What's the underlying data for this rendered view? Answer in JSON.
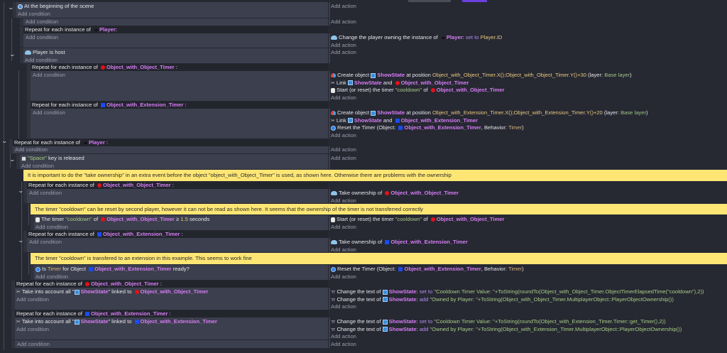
{
  "labels": {
    "add_condition": "Add condition",
    "add_action": "Add action"
  },
  "events": [
    {
      "conditions": [
        [
          {
            "icon": "scene-icon"
          },
          {
            "text": "At the beginning of the scene"
          }
        ]
      ],
      "actions": []
    },
    {
      "conditions": [],
      "actions": []
    },
    {
      "repeat": [
        {
          "text": "Repeat for each instance of "
        },
        {
          "icon": "player-object-icon"
        },
        {
          "text": "Player",
          "style": "obj"
        },
        {
          "text": ":"
        }
      ],
      "conditions": [],
      "actions": [
        [
          {
            "icon": "multiplayer-icon"
          },
          {
            "text": "Change the player owning the instance of "
          },
          {
            "icon": "player-object-icon"
          },
          {
            "text": "Player",
            "style": "obj"
          },
          {
            "text": ": "
          },
          {
            "text": "set to",
            "style": "kw"
          },
          {
            "text": " "
          },
          {
            "text": "Player.ID",
            "style": "expr"
          }
        ]
      ]
    },
    {
      "conditions": [
        [
          {
            "icon": "multiplayer-icon"
          },
          {
            "text": "Player is host"
          }
        ]
      ],
      "actions": []
    },
    {
      "repeat": [
        {
          "text": "Repeat for each instance of "
        },
        {
          "icon": "red-dot-icon"
        },
        {
          "text": "Object_with_Object_Timer",
          "style": "obj"
        },
        {
          "text": " :"
        }
      ],
      "conditions": [],
      "actions": [
        [
          {
            "icon": "create-object-icon"
          },
          {
            "text": "Create object "
          },
          {
            "icon": "showstate-icon"
          },
          {
            "text": "ShowState",
            "style": "obj"
          },
          {
            "text": " at position "
          },
          {
            "text": "Object_with_Object_Timer.X();Object_with_Object_Timer.Y()+30",
            "style": "expr"
          },
          {
            "text": " (layer: "
          },
          {
            "text": "Base layer",
            "style": "layer"
          },
          {
            "text": ")"
          }
        ],
        [
          {
            "icon": "link-icon"
          },
          {
            "text": "Link "
          },
          {
            "icon": "showstate-icon"
          },
          {
            "text": "ShowState",
            "style": "obj"
          },
          {
            "text": " and "
          },
          {
            "icon": "red-dot-icon"
          },
          {
            "text": "Object_with_Object_Timer",
            "style": "obj"
          }
        ],
        [
          {
            "icon": "timer-icon"
          },
          {
            "text": "Start (or reset) the timer "
          },
          {
            "text": "\"cooldown\"",
            "style": "str"
          },
          {
            "text": " of "
          },
          {
            "icon": "red-dot-icon"
          },
          {
            "text": "Object_with_Object_Timer",
            "style": "obj"
          }
        ]
      ]
    },
    {
      "repeat": [
        {
          "text": "Repeat for each instance of "
        },
        {
          "icon": "blue-square-icon"
        },
        {
          "text": "Object_with_Extension_Timer",
          "style": "obj"
        },
        {
          "text": " :"
        }
      ],
      "conditions": [],
      "actions": [
        [
          {
            "icon": "create-object-icon"
          },
          {
            "text": "Create object "
          },
          {
            "icon": "showstate-icon"
          },
          {
            "text": "ShowState",
            "style": "obj"
          },
          {
            "text": " at position "
          },
          {
            "text": "Object_with_Extension_Timer.X();Object_with_Extension_Timer.Y()+20",
            "style": "expr"
          },
          {
            "text": " (layer: "
          },
          {
            "text": "Base layer",
            "style": "layer"
          },
          {
            "text": ")"
          }
        ],
        [
          {
            "icon": "link-icon"
          },
          {
            "text": "Link "
          },
          {
            "icon": "showstate-icon"
          },
          {
            "text": "ShowState",
            "style": "obj"
          },
          {
            "text": " and "
          },
          {
            "icon": "blue-square-icon"
          },
          {
            "text": "Object_with_Extension_Timer",
            "style": "obj"
          }
        ],
        [
          {
            "icon": "extension-timer-icon"
          },
          {
            "text": "Reset the Timer (Object: "
          },
          {
            "icon": "blue-square-icon"
          },
          {
            "text": "Object_with_Extension_Timer",
            "style": "obj"
          },
          {
            "text": ", Behavior: "
          },
          {
            "text": "Timer",
            "style": "beh"
          },
          {
            "text": ")"
          }
        ]
      ]
    },
    {
      "repeat": [
        {
          "text": "Repeat for each instance of "
        },
        {
          "icon": "player-object-icon"
        },
        {
          "text": "Player",
          "style": "obj"
        },
        {
          "text": " :"
        }
      ],
      "conditions": [],
      "actions": []
    },
    {
      "conditions": [
        [
          {
            "icon": "keyboard-icon"
          },
          {
            "text": "\"Space\"",
            "style": "str"
          },
          {
            "text": " key is released"
          }
        ]
      ],
      "actions": []
    },
    {
      "comment": "It is important to do the \"take ownership\" in an extra event before the object \"object_with_Object_Timer\" is used, as shown here. Otherwise there are problems with the ownership"
    },
    {
      "repeat": [
        {
          "text": "Repeat for each instance of "
        },
        {
          "icon": "red-dot-icon"
        },
        {
          "text": "Object_with_Object_Timer",
          "style": "obj"
        },
        {
          "text": " :"
        }
      ],
      "conditions": [],
      "actions": [
        [
          {
            "icon": "multiplayer-icon"
          },
          {
            "text": "Take ownership of "
          },
          {
            "icon": "red-dot-icon"
          },
          {
            "text": "Object_with_Object_Timer",
            "style": "obj"
          }
        ]
      ]
    },
    {
      "comment": "The timer \"cooldown\" can be reset by second player, however it can not be read as shown here. It seems that the ownership of the timer is not transferred correctly"
    },
    {
      "conditions": [
        [
          {
            "icon": "timer-icon"
          },
          {
            "text": "The timer "
          },
          {
            "text": "\"cooldown\"",
            "style": "str"
          },
          {
            "text": " of "
          },
          {
            "icon": "red-dot-icon"
          },
          {
            "text": "Object_with_Object_Timer",
            "style": "obj"
          },
          {
            "text": " ≥ "
          },
          {
            "text": "1.5",
            "style": "expr"
          },
          {
            "text": " seconds"
          }
        ]
      ],
      "actions": [
        [
          {
            "icon": "timer-icon"
          },
          {
            "text": "Start (or reset) the timer "
          },
          {
            "text": "\"cooldown\"",
            "style": "str"
          },
          {
            "text": " of "
          },
          {
            "icon": "red-dot-icon"
          },
          {
            "text": "Object_with_Object_Timer",
            "style": "obj"
          }
        ]
      ]
    },
    {
      "repeat": [
        {
          "text": "Repeat for each instance of "
        },
        {
          "icon": "blue-square-icon"
        },
        {
          "text": "Object_with_Extension_Timer",
          "style": "obj"
        },
        {
          "text": " :"
        }
      ],
      "conditions": [],
      "actions": [
        [
          {
            "icon": "multiplayer-icon"
          },
          {
            "text": "Take ownership of "
          },
          {
            "icon": "blue-square-icon"
          },
          {
            "text": "Object_with_Extension_Timer",
            "style": "obj"
          }
        ]
      ]
    },
    {
      "comment": "The timer \"cooldown\" is transfered to an extension in this example. This seems to work fine"
    },
    {
      "conditions": [
        [
          {
            "icon": "extension-timer-icon"
          },
          {
            "text": "Is "
          },
          {
            "text": "Timer",
            "style": "beh"
          },
          {
            "text": " for Object "
          },
          {
            "icon": "blue-square-icon"
          },
          {
            "text": "Object_with_Extension_Timer",
            "style": "obj"
          },
          {
            "text": " ready?"
          }
        ]
      ],
      "actions": [
        [
          {
            "icon": "extension-timer-icon"
          },
          {
            "text": "Reset the Timer (Object: "
          },
          {
            "icon": "blue-square-icon"
          },
          {
            "text": "Object_with_Extension_Timer",
            "style": "obj"
          },
          {
            "text": ", Behavior: "
          },
          {
            "text": "Timer",
            "style": "beh"
          },
          {
            "text": ")"
          }
        ]
      ]
    },
    {
      "repeat": [
        {
          "text": "Repeat for each instance of "
        },
        {
          "icon": "red-dot-icon"
        },
        {
          "text": "Object_with_Object_Timer",
          "style": "obj"
        },
        {
          "text": " :"
        }
      ],
      "conditions": [
        [
          {
            "icon": "link-icon"
          },
          {
            "text": "Take into account all \""
          },
          {
            "icon": "showstate-icon"
          },
          {
            "text": "ShowState",
            "style": "obj"
          },
          {
            "text": "\" linked to "
          },
          {
            "icon": "red-dot-icon"
          },
          {
            "text": "Object_with_Object_Timer",
            "style": "obj"
          }
        ]
      ],
      "actions": [
        [
          {
            "icon": "text-icon"
          },
          {
            "text": "Change the text of "
          },
          {
            "icon": "showstate-icon"
          },
          {
            "text": "ShowState",
            "style": "obj"
          },
          {
            "text": ": "
          },
          {
            "text": "set to",
            "style": "kw"
          },
          {
            "text": " "
          },
          {
            "text": "\"Cooldown Timer Value: \"+ToString(roundTo(Object_with_Object_Timer.ObjectTimerElapsedTime(\"cooldown\"),2))",
            "style": "str"
          }
        ],
        [
          {
            "icon": "text-icon"
          },
          {
            "text": "Change the text of "
          },
          {
            "icon": "showstate-icon"
          },
          {
            "text": "ShowState",
            "style": "obj"
          },
          {
            "text": ": "
          },
          {
            "text": "add",
            "style": "kw"
          },
          {
            "text": " "
          },
          {
            "text": "\"Owned by Player: \"+ToString(Object_with_Object_Timer.MultiplayerObject::PlayerObjectOwnership())",
            "style": "str"
          }
        ]
      ]
    },
    {
      "repeat": [
        {
          "text": "Repeat for each instance of "
        },
        {
          "icon": "blue-square-icon"
        },
        {
          "text": "Object_with_Extension_Timer",
          "style": "obj"
        },
        {
          "text": " :"
        }
      ],
      "conditions": [
        [
          {
            "icon": "link-icon"
          },
          {
            "text": "Take into account all \""
          },
          {
            "icon": "showstate-icon"
          },
          {
            "text": "ShowState",
            "style": "obj"
          },
          {
            "text": "\" linked to "
          },
          {
            "icon": "blue-square-icon"
          },
          {
            "text": "Object_with_Extension_Timer",
            "style": "obj"
          }
        ]
      ],
      "actions": [
        [
          {
            "icon": "text-icon"
          },
          {
            "text": "Change the text of "
          },
          {
            "icon": "showstate-icon"
          },
          {
            "text": "ShowState",
            "style": "obj"
          },
          {
            "text": ": "
          },
          {
            "text": "set to",
            "style": "kw"
          },
          {
            "text": " "
          },
          {
            "text": "\"Cooldown Timer Value: \"+ToString(roundTo(Object_with_Extension_Timer.Timer::get_Timer(),2))",
            "style": "str"
          }
        ],
        [
          {
            "icon": "text-icon"
          },
          {
            "text": "Change the text of "
          },
          {
            "icon": "showstate-icon"
          },
          {
            "text": "ShowState",
            "style": "obj"
          },
          {
            "text": ": "
          },
          {
            "text": "add",
            "style": "kw"
          },
          {
            "text": " "
          },
          {
            "text": "\"Owned by Player: \"+ToString(Object_with_Extension_Timer.MultiplayerObject::PlayerObjectOwnership())",
            "style": "str"
          }
        ]
      ]
    },
    {
      "conditions": [],
      "actions": []
    }
  ]
}
